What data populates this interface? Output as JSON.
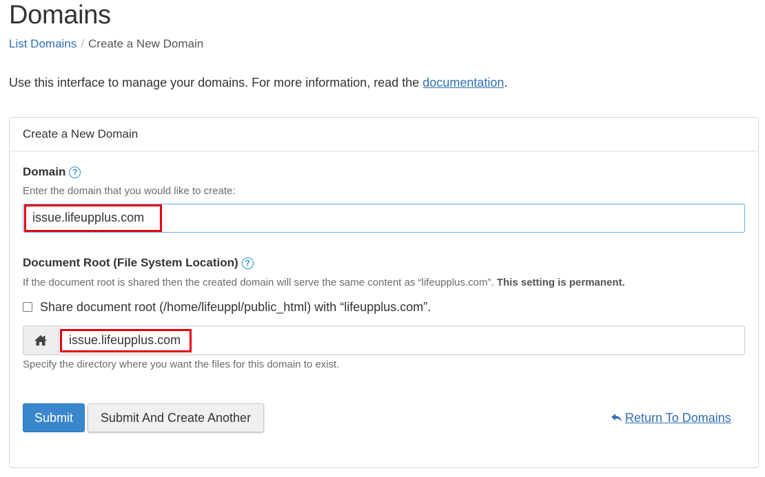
{
  "page": {
    "title": "Domains",
    "breadcrumb": {
      "parent": "List Domains",
      "separator": "/",
      "current": "Create a New Domain"
    },
    "intro_text": "Use this interface to manage your domains. For more information, read the ",
    "intro_link": "documentation",
    "intro_end": "."
  },
  "form": {
    "heading": "Create a New Domain",
    "domain": {
      "label": "Domain",
      "help": "?",
      "hint": "Enter the domain that you would like to create:",
      "value": "issue.lifeupplus.com"
    },
    "docroot": {
      "label": "Document Root (File System Location)",
      "help": "?",
      "hint_text": "If the document root is shared then the created domain will serve the same content as “lifeupplus.com”. ",
      "hint_bold": "This setting is permanent.",
      "share_label": "Share document root (/home/lifeuppl/public_html) with “lifeupplus.com”.",
      "share_checked": false,
      "addon_icon": "home-icon",
      "value": "issue.lifeupplus.com",
      "help_below": "Specify the directory where you want the files for this domain to exist."
    },
    "buttons": {
      "submit": "Submit",
      "submit_another": "Submit And Create Another",
      "return": "Return To Domains"
    }
  },
  "colors": {
    "link": "#2e6fb4",
    "primary_button": "#3a86cc",
    "highlight_box": "#e8000b",
    "focus_border": "#66afe9"
  }
}
